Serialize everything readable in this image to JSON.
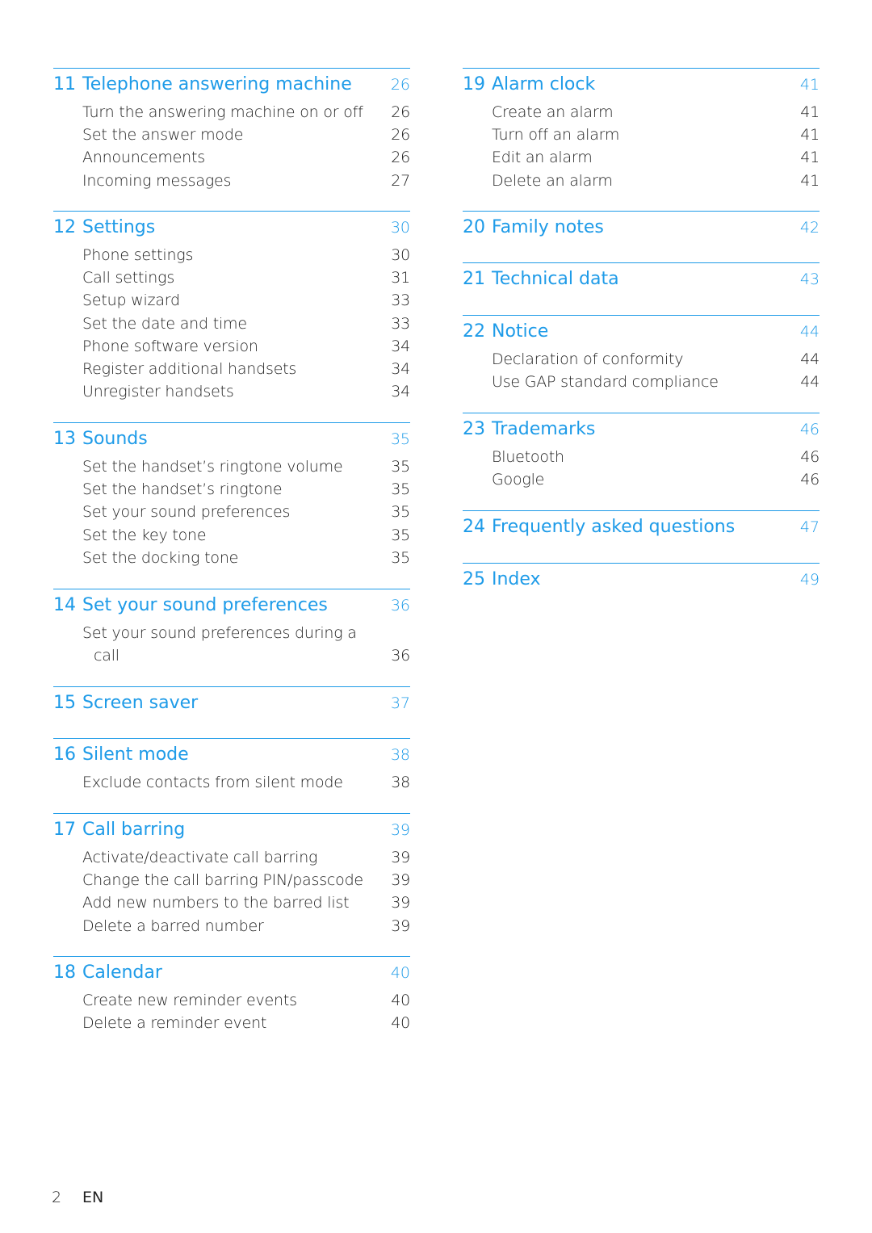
{
  "sections": [
    {
      "num": "11",
      "title": "Telephone answering machine",
      "page": "26",
      "items": [
        {
          "title": "Turn the answering machine on or off",
          "page": "26"
        },
        {
          "title": "Set the answer mode",
          "page": "26"
        },
        {
          "title": "Announcements",
          "page": "26"
        },
        {
          "title": "Incoming messages",
          "page": "27"
        }
      ]
    },
    {
      "num": "12",
      "title": "Settings",
      "page": "30",
      "items": [
        {
          "title": "Phone settings",
          "page": "30"
        },
        {
          "title": "Call settings",
          "page": "31"
        },
        {
          "title": "Setup wizard",
          "page": "33"
        },
        {
          "title": "Set the date and time",
          "page": "33"
        },
        {
          "title": "Phone software version",
          "page": "34"
        },
        {
          "title": "Register additional handsets",
          "page": "34"
        },
        {
          "title": "Unregister handsets",
          "page": "34"
        }
      ]
    },
    {
      "num": "13",
      "title": "Sounds",
      "page": "35",
      "items": [
        {
          "title": "Set the handset’s ringtone volume",
          "page": "35"
        },
        {
          "title": "Set the handset’s ringtone",
          "page": "35"
        },
        {
          "title": "Set your sound preferences",
          "page": "35"
        },
        {
          "title": "Set the key tone",
          "page": "35"
        },
        {
          "title": "Set the docking tone",
          "page": "35"
        }
      ]
    },
    {
      "num": "14",
      "title": "Set your sound preferences",
      "page": "36",
      "items": [
        {
          "title": "Set your sound preferences during a call",
          "page": "36",
          "wrap": true
        }
      ]
    },
    {
      "num": "15",
      "title": "Screen saver",
      "page": "37",
      "items": []
    },
    {
      "num": "16",
      "title": "Silent mode",
      "page": "38",
      "items": [
        {
          "title": "Exclude contacts from silent mode",
          "page": "38"
        }
      ]
    },
    {
      "num": "17",
      "title": "Call barring",
      "page": "39",
      "items": [
        {
          "title": "Activate/deactivate call barring",
          "page": "39"
        },
        {
          "title": "Change the call barring PIN/passcode",
          "page": "39"
        },
        {
          "title": "Add new numbers to the barred list",
          "page": "39"
        },
        {
          "title": "Delete a barred number",
          "page": "39"
        }
      ]
    },
    {
      "num": "18",
      "title": "Calendar",
      "page": "40",
      "items": [
        {
          "title": "Create new reminder events",
          "page": "40"
        },
        {
          "title": "Delete a reminder event",
          "page": "40"
        }
      ]
    },
    {
      "num": "19",
      "title": "Alarm clock",
      "page": "41",
      "items": [
        {
          "title": "Create an alarm",
          "page": "41"
        },
        {
          "title": "Turn off an alarm",
          "page": "41"
        },
        {
          "title": "Edit an alarm",
          "page": "41"
        },
        {
          "title": "Delete an alarm",
          "page": "41"
        }
      ]
    },
    {
      "num": "20",
      "title": "Family notes",
      "page": "42",
      "items": []
    },
    {
      "num": "21",
      "title": "Technical data",
      "page": "43",
      "items": []
    },
    {
      "num": "22",
      "title": "Notice",
      "page": "44",
      "items": [
        {
          "title": "Declaration of conformity",
          "page": "44"
        },
        {
          "title": "Use GAP standard compliance",
          "page": "44"
        }
      ]
    },
    {
      "num": "23",
      "title": "Trademarks",
      "page": "46",
      "items": [
        {
          "title": "Bluetooth",
          "page": "46"
        },
        {
          "title": "Google",
          "page": "46"
        }
      ]
    },
    {
      "num": "24",
      "title": "Frequently asked questions",
      "page": "47",
      "items": []
    },
    {
      "num": "25",
      "title": "Index",
      "page": "49",
      "items": []
    }
  ],
  "footer": {
    "page_number": "2",
    "language": "EN"
  },
  "colors": {
    "accent": "#1e9be8",
    "text": "#222222"
  }
}
